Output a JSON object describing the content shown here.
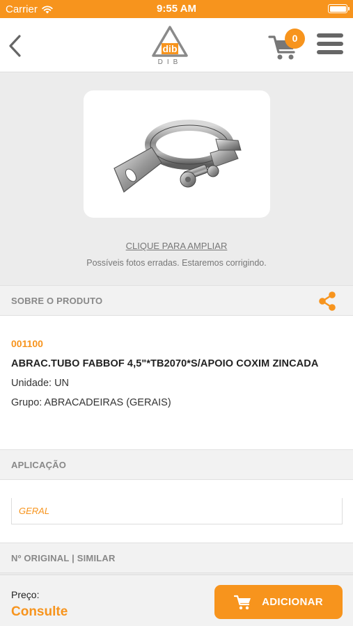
{
  "status_bar": {
    "carrier": "Carrier",
    "time": "9:55 AM"
  },
  "header": {
    "logo_text": "DIB",
    "logo_mark": "dib",
    "cart_count": "0",
    "icons": {
      "back": "chevron-left-icon",
      "cart": "cart-icon",
      "menu": "hamburger-menu-icon"
    }
  },
  "gallery": {
    "zoom_link": "CLIQUE PARA AMPLIAR",
    "note": "Possíveis fotos erradas. Estaremos corrigindo."
  },
  "about": {
    "section_title": "SOBRE O PRODUTO",
    "code": "001100",
    "name": "ABRAC.TUBO FABBOF 4,5\"*TB2070*S/APOIO COXIM ZINCADA",
    "unit": "Unidade: UN",
    "group": "Grupo: ABRACADEIRAS (GERAIS)"
  },
  "application": {
    "section_title": "APLICAÇÃO",
    "tags": [
      "GERAL"
    ]
  },
  "original": {
    "section_title": "Nº ORIGINAL | SIMILAR"
  },
  "footer": {
    "price_label": "Preço:",
    "price_value": "Consulte",
    "add_button_label": "ADICIONAR"
  },
  "colors": {
    "accent": "#f7941d",
    "background": "#ececec",
    "section_header": "#f2f2f2"
  }
}
